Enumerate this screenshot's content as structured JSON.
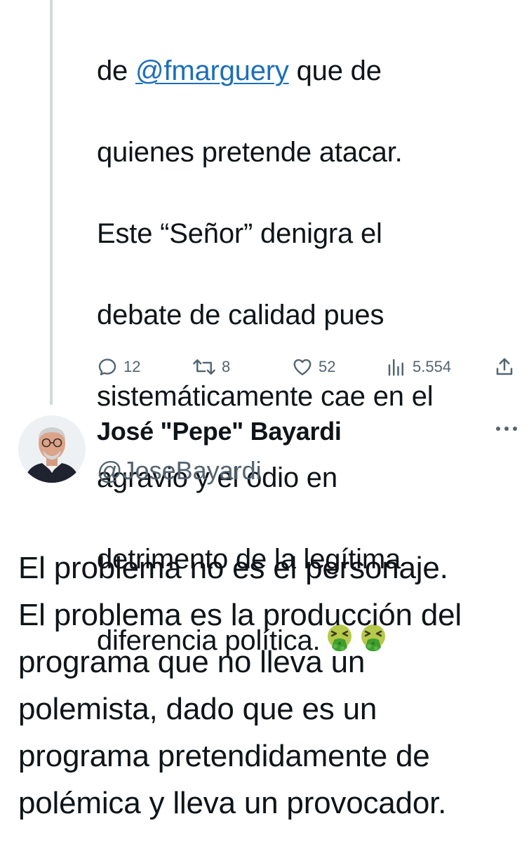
{
  "parent_tweet": {
    "text_before_mention": "de ",
    "mention": "@fmarguery",
    "lines": [
      " que de",
      "quienes pretende atacar.",
      "Este “Señor” denigra el",
      "debate de calidad pues",
      "sistemáticamente cae en el",
      "agravio y el odio en",
      "detrimento de la legítima",
      "diferencia política."
    ],
    "emojis": [
      "vomiting-face-icon",
      "vomiting-face-icon"
    ],
    "actions": {
      "replies": "12",
      "retweets": "8",
      "likes": "52",
      "views": "5.554"
    }
  },
  "reply_tweet": {
    "display_name": "José \"Pepe\" Bayardi",
    "handle": "@JoseBayardi",
    "text_lines": [
      "El problema no es el personaje.",
      "El problema es la producción del",
      "programa que no lleva un",
      "polemista, dado que es un",
      "programa pretendidamente de",
      "polémica y lleva un provocador."
    ]
  },
  "colors": {
    "text": "#0f1419",
    "secondary": "#536471",
    "link": "#1d6fb8",
    "thread_line": "#cfd9de",
    "emoji_face": "#b6c94a",
    "emoji_vomit": "#3f9e2f"
  }
}
